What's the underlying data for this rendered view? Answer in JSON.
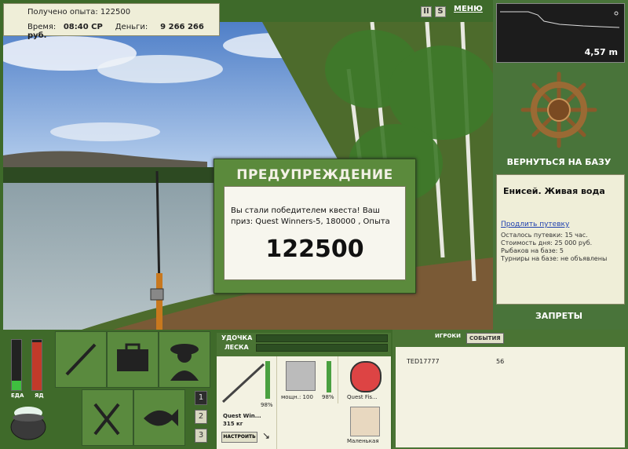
{
  "info": {
    "xp_label": "Получено опыта:",
    "xp_value": "122500",
    "time_label": "Время:",
    "time_value": "08:40 СР",
    "money_label": "Деньги:",
    "money_value": "9 266 266 руб."
  },
  "top": {
    "pause_label": "II",
    "s_label": "S",
    "menu_label": "МЕНЮ"
  },
  "depth": {
    "value": "4,57 m"
  },
  "base": {
    "return_label": "ВЕРНУТЬСЯ НА БАЗУ",
    "title": "Енисей. Живая вода",
    "extend_link": "Продлить путевку",
    "lines": [
      "Осталось путевки: 15 час.",
      "Стоимость дня: 25 000 руб.",
      "Рыбаков на базе: 5",
      "Турниры на базе: не объявлены"
    ],
    "bans_label": "ЗАПРЕТЫ"
  },
  "warning": {
    "title": "ПРЕДУПРЕЖДЕНИЕ",
    "text": "Вы стали победителем квеста! Ваш приз: Quest Winners-5, 180000 , Опыта",
    "number": "122500"
  },
  "gauges": {
    "food_label": "ЕДА",
    "poison_label": "ЯД",
    "food_level": 0.18,
    "poison_level": 0.95
  },
  "tabs": [
    "1",
    "2",
    "3"
  ],
  "tackle": {
    "rod_label": "УДОЧКА",
    "line_label": "ЛЕСКА",
    "rod_name": "Quest Win...",
    "rod_weight": "315 кг",
    "rod_pct": "98%",
    "reel_label": "мощн.: 100",
    "reel_pct": "98%",
    "line_name": "Quest Fis...",
    "lure_name": "Маленькая",
    "setup_label": "НАСТРОИТЬ"
  },
  "players": {
    "tab_players": "ИГРОКИ",
    "tab_events": "СОБЫТИЯ",
    "rows": [
      {
        "name": "TED17777",
        "value": "56"
      }
    ]
  },
  "colors": {
    "panel_green": "#49743a",
    "paper": "#efeed8",
    "link_blue": "#1d3fae"
  }
}
